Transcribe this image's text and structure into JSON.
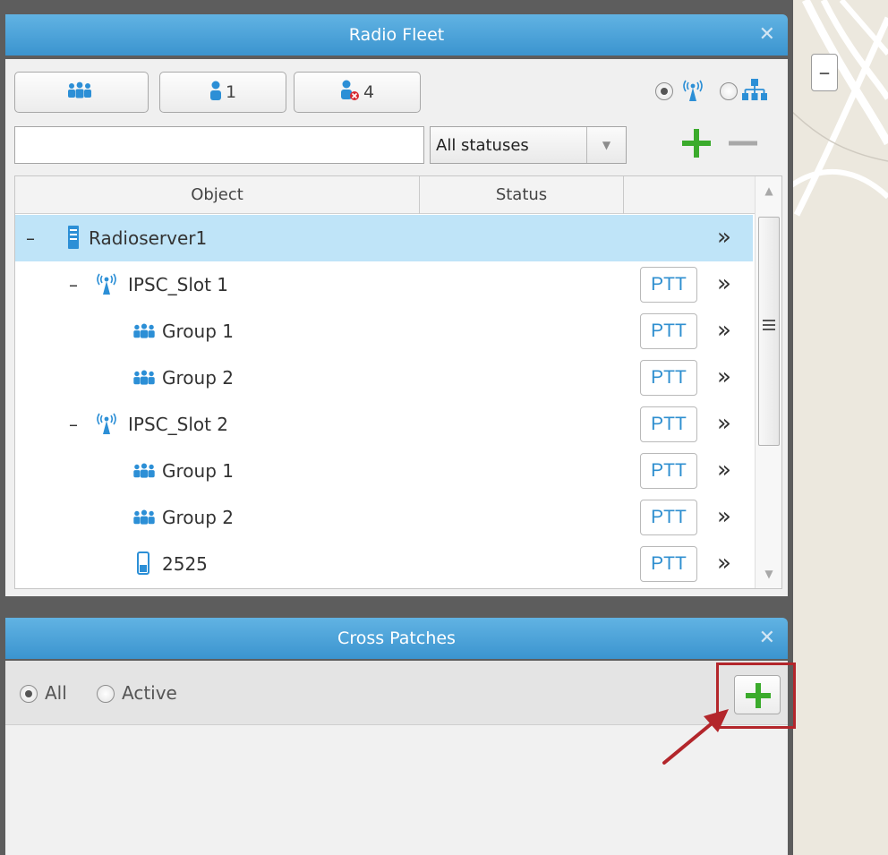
{
  "radio_fleet": {
    "title": "Radio Fleet",
    "close_icon": "close-icon",
    "toolbar": {
      "all_groups_button": {
        "icon": "group-icon",
        "label": ""
      },
      "online_users_button": {
        "icon": "user-icon",
        "label": "1"
      },
      "offline_users_button": {
        "icon": "user-offline-icon",
        "label": "4"
      }
    },
    "view_mode": {
      "options": [
        "radio-network-icon",
        "hierarchy-icon"
      ],
      "selected": 0
    },
    "search": {
      "value": "",
      "placeholder": ""
    },
    "status_filter": {
      "value": "All statuses"
    },
    "add_icon": "plus-icon",
    "remove_icon": "minus-icon",
    "columns": [
      "Object",
      "Status",
      ""
    ],
    "rows": [
      {
        "name": "Radioserver1",
        "type": "server",
        "expand": "–",
        "level": 0,
        "ptt": null,
        "action": "»",
        "selected": true
      },
      {
        "name": "IPSC_Slot 1",
        "type": "slot",
        "expand": "–",
        "level": 1,
        "ptt": "PTT",
        "action": "»",
        "selected": false
      },
      {
        "name": "Group 1",
        "type": "group",
        "expand": "",
        "level": 2,
        "ptt": "PTT",
        "action": "»",
        "selected": false
      },
      {
        "name": "Group 2",
        "type": "group",
        "expand": "",
        "level": 2,
        "ptt": "PTT",
        "action": "»",
        "selected": false
      },
      {
        "name": "IPSC_Slot 2",
        "type": "slot",
        "expand": "–",
        "level": 1,
        "ptt": "PTT",
        "action": "»",
        "selected": false
      },
      {
        "name": "Group 1",
        "type": "group",
        "expand": "",
        "level": 2,
        "ptt": "PTT",
        "action": "»",
        "selected": false
      },
      {
        "name": "Group 2",
        "type": "group",
        "expand": "",
        "level": 2,
        "ptt": "PTT",
        "action": "»",
        "selected": false
      },
      {
        "name": "2525",
        "type": "radio",
        "expand": "",
        "level": 2,
        "ptt": "PTT",
        "action": "»",
        "selected": false
      }
    ]
  },
  "cross_patches": {
    "title": "Cross Patches",
    "close_icon": "close-icon",
    "filter": {
      "options": [
        "All",
        "Active"
      ],
      "selected": "All"
    },
    "add_icon": "plus-icon"
  },
  "map": {
    "zoom_out_label": "–"
  },
  "colors": {
    "accent": "#3b94cf",
    "ptt_text": "#2f8fd0",
    "add_green": "#3bab2c",
    "highlight": "#b3262b"
  }
}
